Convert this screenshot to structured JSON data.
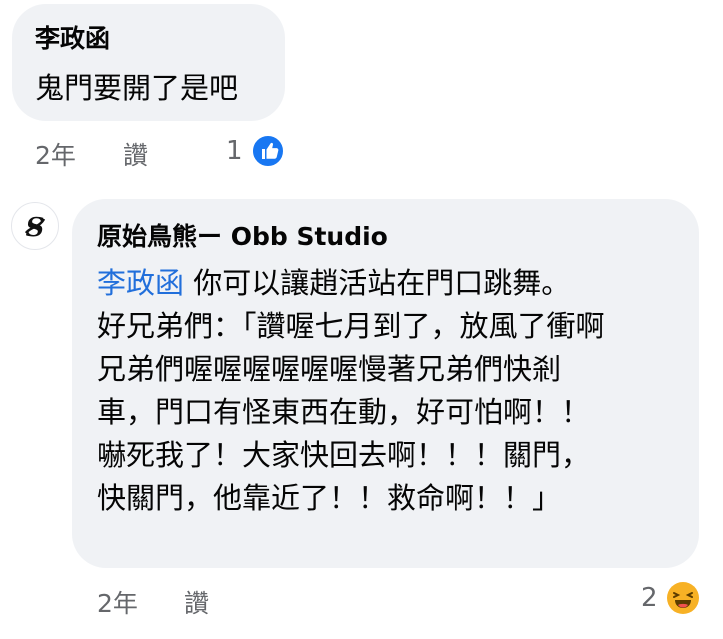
{
  "comments": [
    {
      "author": "李政函",
      "text": "鬼門要開了是吧",
      "time": "2年",
      "like_label": "讚",
      "reaction_count": "1",
      "reaction_icon": "like-icon"
    },
    {
      "author": "原始鳥熊ー Obb Studio",
      "mention": "李政函",
      "lines": [
        " 你可以讓趙活站在門口跳舞。",
        "好兄弟們：「讚喔七月到了，放風了衝啊",
        "兄弟們喔喔喔喔喔喔慢著兄弟們快剎",
        "車，門口有怪東西在動，好可怕啊！！",
        "嚇死我了！大家快回去啊！！！關門，",
        "快關門，他靠近了！！救命啊！！」"
      ],
      "time": "2年",
      "like_label": "讚",
      "reaction_count": "2",
      "reaction_icon": "haha-icon"
    }
  ],
  "colors": {
    "bubble_bg": "#f0f2f5",
    "mention": "#216fdb",
    "meta": "#65676b",
    "like_blue": "#1877f2",
    "haha_yellow": "#f7b125"
  }
}
